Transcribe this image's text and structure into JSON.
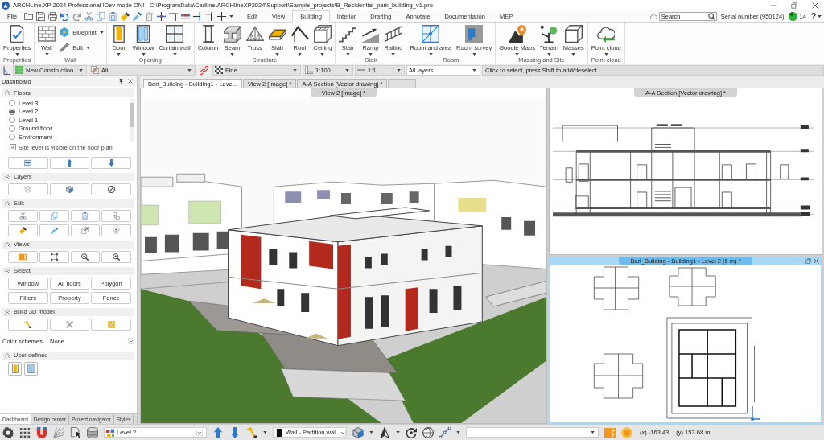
{
  "window": {
    "title": "ARCHLine.XP 2024 Professional !Dev mode ON! - C:\\ProgramData\\Cadline\\ARCHlineXP2024\\Support\\Sample_projects\\B_Residential_park_building_v1.pro"
  },
  "menu": {
    "file": "File",
    "tabs": [
      {
        "label": "Edit",
        "selected": false
      },
      {
        "label": "View",
        "selected": false
      },
      {
        "label": "Building",
        "selected": true
      },
      {
        "label": "Interior",
        "selected": false
      },
      {
        "label": "Drafting",
        "selected": false
      },
      {
        "label": "Annotate",
        "selected": false
      },
      {
        "label": "Documentation",
        "selected": false
      },
      {
        "label": "MEP",
        "selected": false
      }
    ],
    "search": {
      "placeholder": "Search"
    },
    "serial": "Serial number (950124)",
    "badge": "14",
    "help": "?"
  },
  "ribbon": {
    "groups": [
      {
        "label": "Properties",
        "tools": [
          {
            "label": "Properties",
            "kind": "large",
            "has_menu": true
          }
        ]
      },
      {
        "label": "Wall",
        "tools": [
          {
            "label": "Wall",
            "kind": "large",
            "has_menu": true
          },
          {
            "label": "Blueprint",
            "kind": "small",
            "has_menu": true
          },
          {
            "label": "Edit",
            "kind": "small",
            "has_menu": true
          }
        ]
      },
      {
        "label": "Opening",
        "tools": [
          {
            "label": "Door",
            "kind": "large",
            "has_menu": true
          },
          {
            "label": "Window",
            "kind": "large",
            "has_menu": true
          },
          {
            "label": "Curtain wall",
            "kind": "large",
            "has_menu": true
          }
        ]
      },
      {
        "label": "Structure",
        "tools": [
          {
            "label": "Column",
            "kind": "large",
            "has_menu": false
          },
          {
            "label": "Beam",
            "kind": "large",
            "has_menu": true
          },
          {
            "label": "Truss",
            "kind": "large",
            "has_menu": false
          },
          {
            "label": "Slab",
            "kind": "large",
            "has_menu": true
          },
          {
            "label": "Roof",
            "kind": "large",
            "has_menu": true
          },
          {
            "label": "Ceiling",
            "kind": "large",
            "has_menu": true
          }
        ]
      },
      {
        "label": "Stair",
        "tools": [
          {
            "label": "Stair",
            "kind": "large",
            "has_menu": true
          },
          {
            "label": "Ramp",
            "kind": "large",
            "has_menu": true
          },
          {
            "label": "Railing",
            "kind": "large",
            "has_menu": true
          }
        ]
      },
      {
        "label": "Room",
        "tools": [
          {
            "label": "Room and area",
            "kind": "large",
            "has_menu": true
          },
          {
            "label": "Room survey",
            "kind": "large",
            "has_menu": true
          }
        ]
      },
      {
        "label": "Massing and Site",
        "tools": [
          {
            "label": "Google Maps",
            "kind": "large",
            "has_menu": true
          },
          {
            "label": "Terrain",
            "kind": "large",
            "has_menu": true
          },
          {
            "label": "Masses",
            "kind": "large",
            "has_menu": true
          }
        ]
      },
      {
        "label": "Point cloud",
        "tools": [
          {
            "label": "Point cloud",
            "kind": "large",
            "has_menu": true
          }
        ]
      }
    ]
  },
  "toolbar": {
    "phase": "New Construction",
    "filter": "All",
    "detail": "Fine",
    "scale": "1:100",
    "ratio": "1:1",
    "layers": "All layers",
    "hint": "Click to select, press Shift to add/deselect"
  },
  "dashboard": {
    "title": "Dashboard",
    "sections": [
      {
        "kind": "floors",
        "title": "Floors",
        "expanded": true,
        "floors": [
          {
            "label": "Level 3",
            "selected": false
          },
          {
            "label": "Level 2",
            "selected": true
          },
          {
            "label": "Level 1",
            "selected": false
          },
          {
            "label": "Ground floor",
            "selected": false
          },
          {
            "label": "Environment",
            "selected": false
          }
        ],
        "site_level": {
          "label": "Site level is visible on the floor plan",
          "checked": true,
          "disabled": true
        }
      },
      {
        "kind": "icons",
        "title": "Layers",
        "expanded": true
      },
      {
        "kind": "icons",
        "title": "Edit",
        "expanded": true
      },
      {
        "kind": "icons",
        "title": "Views",
        "expanded": true
      },
      {
        "kind": "buttons",
        "title": "Select",
        "expanded": true,
        "buttons": [
          "Window",
          "All floors",
          "Polygon",
          "Filters",
          "Property",
          "Fence"
        ]
      },
      {
        "kind": "icons",
        "title": "Build 3D model",
        "expanded": true
      },
      {
        "kind": "scheme",
        "label": "Color schemes",
        "value": "None"
      },
      {
        "kind": "small_icons",
        "title": "User defined",
        "expanded": true
      }
    ],
    "tabs": [
      {
        "label": "Dashboard",
        "selected": true
      },
      {
        "label": "Design center",
        "selected": false
      },
      {
        "label": "Project navigator",
        "selected": false
      },
      {
        "label": "Styles",
        "selected": false
      }
    ]
  },
  "views": {
    "tabs": [
      {
        "label": "Bari_Building - Building1 - Leve...",
        "selected": true
      },
      {
        "label": "View 2 [Image] *",
        "selected": false
      },
      {
        "label": "A-A Section [Vector drawing] *",
        "selected": false
      }
    ],
    "new_tab": "+",
    "panes": [
      {
        "kind": "render",
        "title": "View 2 [Image] *",
        "active": false
      },
      {
        "kind": "section",
        "title": "A-A Section [Vector drawing] *",
        "active": false
      },
      {
        "kind": "plan",
        "title": "Bari_Building - Building1 - Level 2 (6 m) *",
        "active": true
      }
    ]
  },
  "status_bar": {
    "floor": "Level 2",
    "element": "Wall - Partition wall",
    "x": "(x) -163.43",
    "y": "(y) 153.68 m"
  }
}
